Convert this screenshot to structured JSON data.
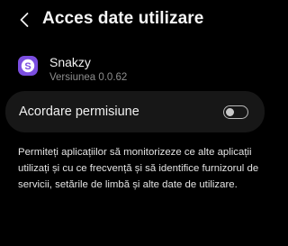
{
  "header": {
    "back_icon": "chevron-left-icon",
    "title": "Acces date utilizare"
  },
  "app": {
    "icon": "snakzy-app-icon",
    "icon_color": "#7b4ee0",
    "icon_letter": "S",
    "name": "Snakzy",
    "version": "Versiunea 0.0.62"
  },
  "permission": {
    "label": "Acordare permisiune",
    "enabled": false
  },
  "description": "Permiteți aplicațiilor să monitorizeze ce alte aplicații utilizați și cu ce frecvență și să identifice furnizorul de servicii, setările de limbă și alte date de utilizare.",
  "colors": {
    "background": "#000000",
    "card": "#171717",
    "text_primary": "#f0f0f0",
    "text_secondary": "#8d8d8d"
  }
}
